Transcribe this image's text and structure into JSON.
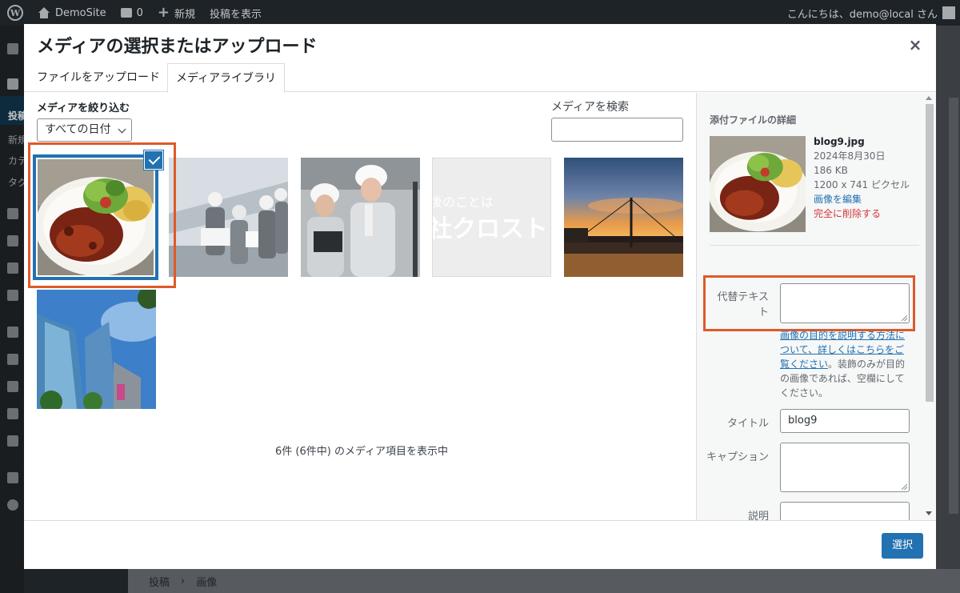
{
  "adminbar": {
    "site_name": "DemoSite",
    "comments_count": "0",
    "new_label": "新規",
    "view_post_label": "投稿を表示",
    "greeting": "こんにちは、demo@local さん"
  },
  "admin_sidebar": {
    "items": [
      "投稿",
      "新規",
      "カテ",
      "タグ"
    ]
  },
  "background": {
    "breadcrumb_posts": "投稿",
    "breadcrumb_sep": "›",
    "breadcrumb_images": "画像"
  },
  "modal": {
    "title": "メディアの選択またはアップロード",
    "close_icon": "×",
    "tabs": [
      {
        "label": "ファイルをアップロード",
        "active": false
      },
      {
        "label": "メディアライブラリ",
        "active": true
      }
    ],
    "filter_label": "メディアを絞り込む",
    "date_filter_value": "すべての日付",
    "search_label": "メディアを検索",
    "search_value": "",
    "watermark_line1": "後のことは",
    "watermark_line2": "社クロスト",
    "count_text": "6件 (6件中) のメディア項目を表示中",
    "select_button": "選択"
  },
  "attachment_details": {
    "heading": "添付ファイルの詳細",
    "filename": "blog9.jpg",
    "date": "2024年8月30日",
    "filesize": "186 KB",
    "dimensions": "1200 x 741 ピクセル",
    "edit_link": "画像を編集",
    "delete_link": "完全に削除する",
    "alt_label": "代替テキスト",
    "alt_value": "",
    "alt_help_link": "画像の目的を説明する方法について、詳しくはこちらをご覧ください",
    "alt_help_text": "。装飾のみが目的の画像であれば、空欄にしてください。",
    "title_label": "タイトル",
    "title_value": "blog9",
    "caption_label": "キャプション",
    "caption_value": "",
    "description_label": "説明",
    "description_value": ""
  },
  "colors": {
    "accent": "#2271b1",
    "highlight": "#dd5a2a",
    "danger": "#d63638"
  }
}
